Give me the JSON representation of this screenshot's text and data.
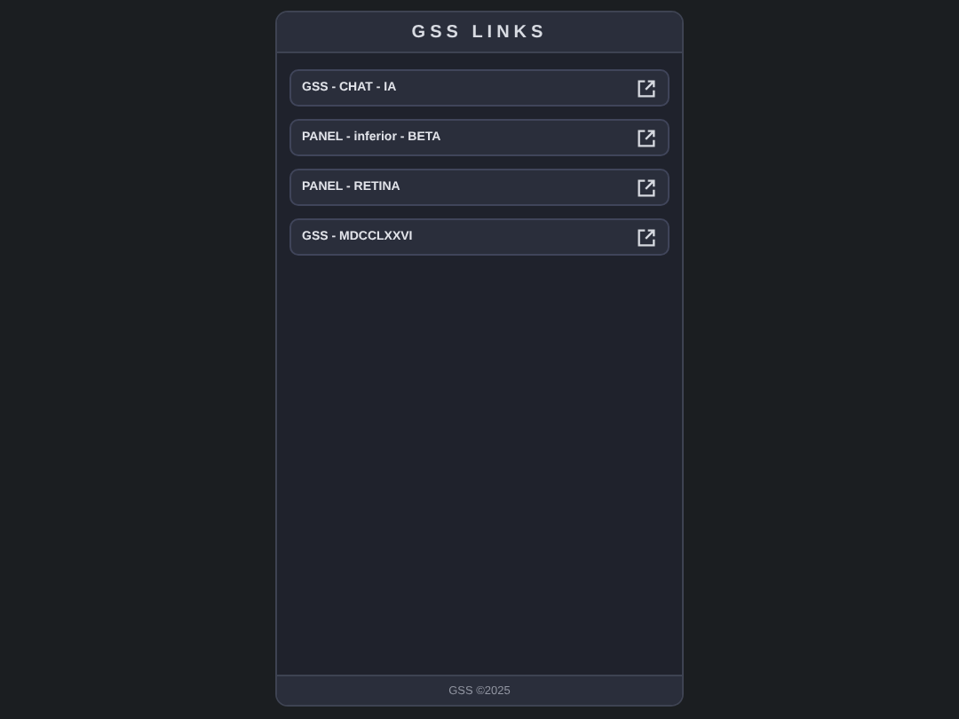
{
  "header": {
    "title": "GSS LINKS"
  },
  "links": [
    {
      "label": "GSS - CHAT - IA"
    },
    {
      "label": "PANEL - inferior - BETA"
    },
    {
      "label": "PANEL - RETINA"
    },
    {
      "label": "GSS - MDCCLXXVI"
    }
  ],
  "footer": {
    "text": "GSS ©2025"
  }
}
